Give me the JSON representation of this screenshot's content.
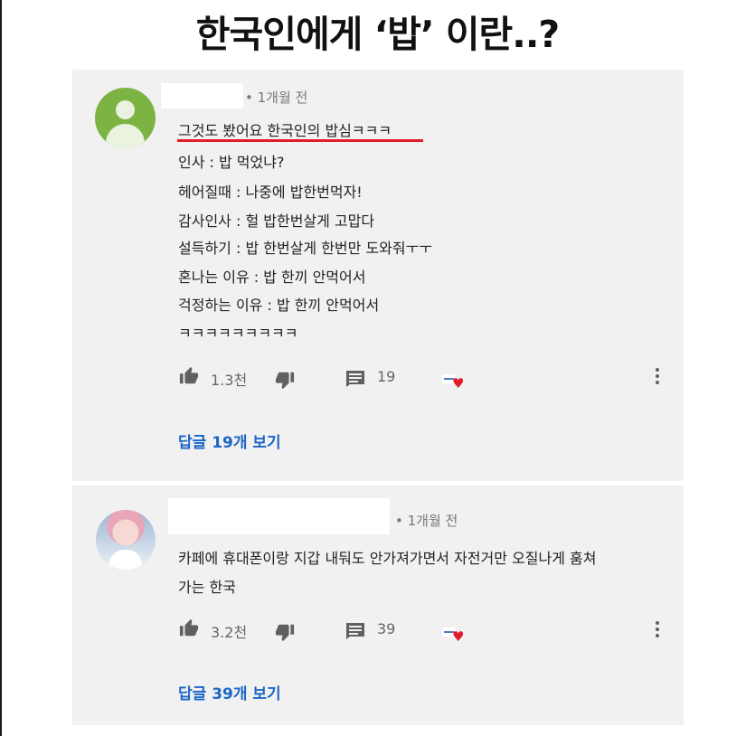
{
  "headline": "한국인에게 ‘밥’ 이란..?",
  "comments": [
    {
      "time": "• 1개월 전",
      "lines": [
        "그것도 봤어요 한국인의 밥심ㅋㅋㅋ",
        "인사 : 밥 먹었냐?",
        "헤어질때 : 나중에 밥한번먹자!",
        "감사인사 : 헐 밥한번살게 고맙다",
        "설득하기 : 밥 한번살게 한번만 도와줘ㅜㅜ",
        "혼나는 이유 : 밥 한끼 안먹어서",
        "걱정하는 이유 : 밥 한끼 안먹어서",
        "ㅋㅋㅋㅋㅋㅋㅋㅋㅋ"
      ],
      "likes": "1.3천",
      "reply_count": "19",
      "replies_link": "답글 19개 보기"
    },
    {
      "time": "• 1개월 전",
      "lines": [
        "카페에 휴대폰이랑 지갑 내둬도 안가져가면서 자전거만 오질나게 훔쳐",
        "가는 한국"
      ],
      "likes": "3.2천",
      "reply_count": "39",
      "replies_link": "답글 39개 보기"
    }
  ],
  "colors": {
    "panel_bg": "#f1f1f1",
    "highlight_underline": "#e01e2b",
    "link": "#1b66c6",
    "heart": "#e21b2b",
    "default_avatar": "#7cb342"
  },
  "icons": {
    "like": "thumbs-up-icon",
    "dislike": "thumbs-down-icon",
    "reply": "comment-icon",
    "creator_heart": "heart-icon",
    "more": "more-vert-icon"
  }
}
